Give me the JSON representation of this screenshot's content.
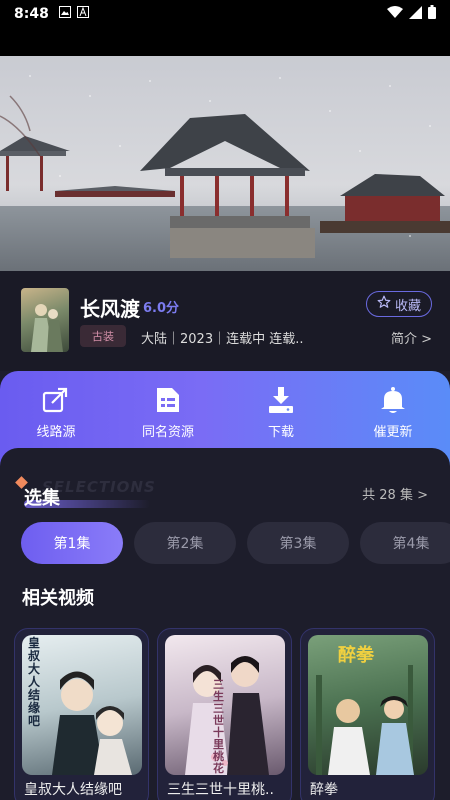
{
  "status_bar": {
    "time": "8:48"
  },
  "show": {
    "title": "长风渡",
    "score": "6.0分",
    "favorite_label": "收藏",
    "tag": "古装",
    "meta": "大陆｜2023｜连载中 连载..",
    "intro_label": "简介 >"
  },
  "actions": [
    {
      "label": "线路源",
      "icon": "external-link-icon"
    },
    {
      "label": "同名资源",
      "icon": "folder-list-icon"
    },
    {
      "label": "下载",
      "icon": "download-icon"
    },
    {
      "label": "催更新",
      "icon": "bell-icon"
    }
  ],
  "episodes_section": {
    "watermark": "SELECTIONS",
    "title": "选集",
    "total": "共 28 集 >",
    "items": [
      "第1集",
      "第2集",
      "第3集",
      "第4集"
    ],
    "selected_index": 0
  },
  "related": {
    "title": "相关视频",
    "items": [
      {
        "caption": "皇叔大人结缘吧",
        "poster_text": "皇叔大人结缘吧"
      },
      {
        "caption": "三生三世十里桃..",
        "poster_text": "三生三世十里桃花"
      },
      {
        "caption": "醉拳",
        "poster_text": "醉拳"
      }
    ]
  },
  "colors": {
    "accent": "#7c6cf0",
    "action_gradient_start": "#6a5cf0",
    "action_gradient_end": "#5a8cf8",
    "background": "#1d1d2b"
  }
}
